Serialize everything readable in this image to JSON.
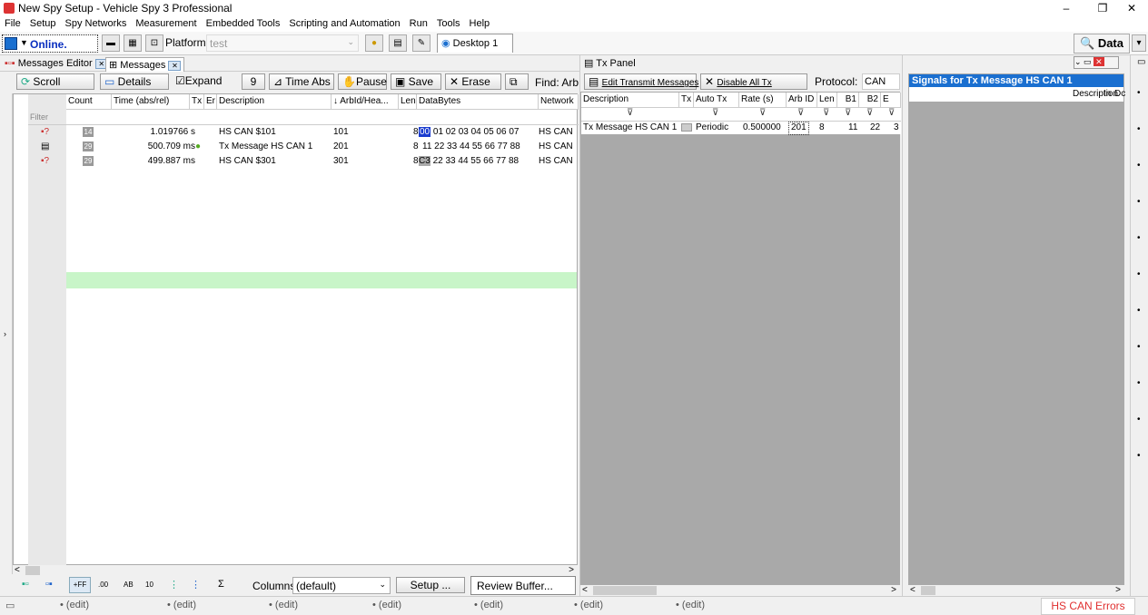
{
  "window": {
    "title": "New Spy Setup - Vehicle Spy 3 Professional",
    "min": "–",
    "max": "❐",
    "close": "✕"
  },
  "menu": [
    "File",
    "Setup",
    "Spy Networks",
    "Measurement",
    "Embedded Tools",
    "Scripting and Automation",
    "Run",
    "Tools",
    "Help"
  ],
  "toolbar": {
    "status": "Online.",
    "platform_label": "Platform:",
    "platform_value": "test",
    "desktop_tab": "Desktop 1",
    "data_button": "Data"
  },
  "left_tabs": {
    "editor": "Messages Editor",
    "messages": "Messages"
  },
  "msg_toolbar": {
    "scroll": "Scroll",
    "details": "Details",
    "expand": "Expand",
    "nine": "9",
    "time_abs": "Time Abs",
    "pause": "Pause",
    "save": "Save",
    "erase": "Erase",
    "find": "Find: Arb"
  },
  "columns": {
    "count": "Count",
    "time": "Time (abs/rel)",
    "tx": "Tx",
    "er": "Er",
    "desc": "Description",
    "arbid": "ArbId/Hea...",
    "len": "Len",
    "data": "DataBytes",
    "network": "Network",
    "filter": "Filter"
  },
  "messages": [
    {
      "count": "14",
      "time": "1.019766 s",
      "desc": "HS CAN $101",
      "arbid": "101",
      "len": "8",
      "first": "00",
      "data": "01 02 03 04 05 06 07",
      "network": "HS CAN"
    },
    {
      "count": "29",
      "time": "500.709 ms",
      "desc": "Tx Message HS CAN 1",
      "arbid": "201",
      "len": "8",
      "first": "",
      "data": "11 22 33 44 55 66 77 88",
      "network": "HS CAN"
    },
    {
      "count": "29",
      "time": "499.887 ms",
      "desc": "HS CAN $301",
      "arbid": "301",
      "len": "8",
      "first": "C3",
      "data": "22 33 44 55 66 77 88",
      "network": "HS CAN"
    }
  ],
  "bottom_bar": {
    "ff": "+FF",
    "d00": ".00",
    "ab": "AB",
    "ten": "10",
    "columns_label": "Columns",
    "columns_value": "(default)",
    "setup": "Setup ...",
    "review": "Review Buffer..."
  },
  "tx_panel": {
    "title": "Tx Panel",
    "edit": "Edit Transmit Messages",
    "disable": "Disable All Tx",
    "protocol_label": "Protocol:",
    "protocol_value": "CAN",
    "cols": {
      "desc": "Description",
      "tx": "Tx",
      "auto": "Auto Tx",
      "rate": "Rate (s)",
      "arbid": "Arb ID",
      "len": "Len",
      "b1": "B1",
      "b2": "B2",
      "b3": "E"
    },
    "row": {
      "desc": "Tx Message HS CAN 1",
      "auto": "Periodic",
      "rate": "0.500000",
      "arbid": "201",
      "len": "8",
      "b1": "11",
      "b2": "22",
      "b3": "3"
    }
  },
  "signals": {
    "title": "Signals for Tx Message HS CAN 1",
    "desc": "Description",
    "in": "In",
    "dc": "Dc"
  },
  "statusbar": {
    "edit": "(edit)",
    "errors": "HS CAN Errors"
  }
}
